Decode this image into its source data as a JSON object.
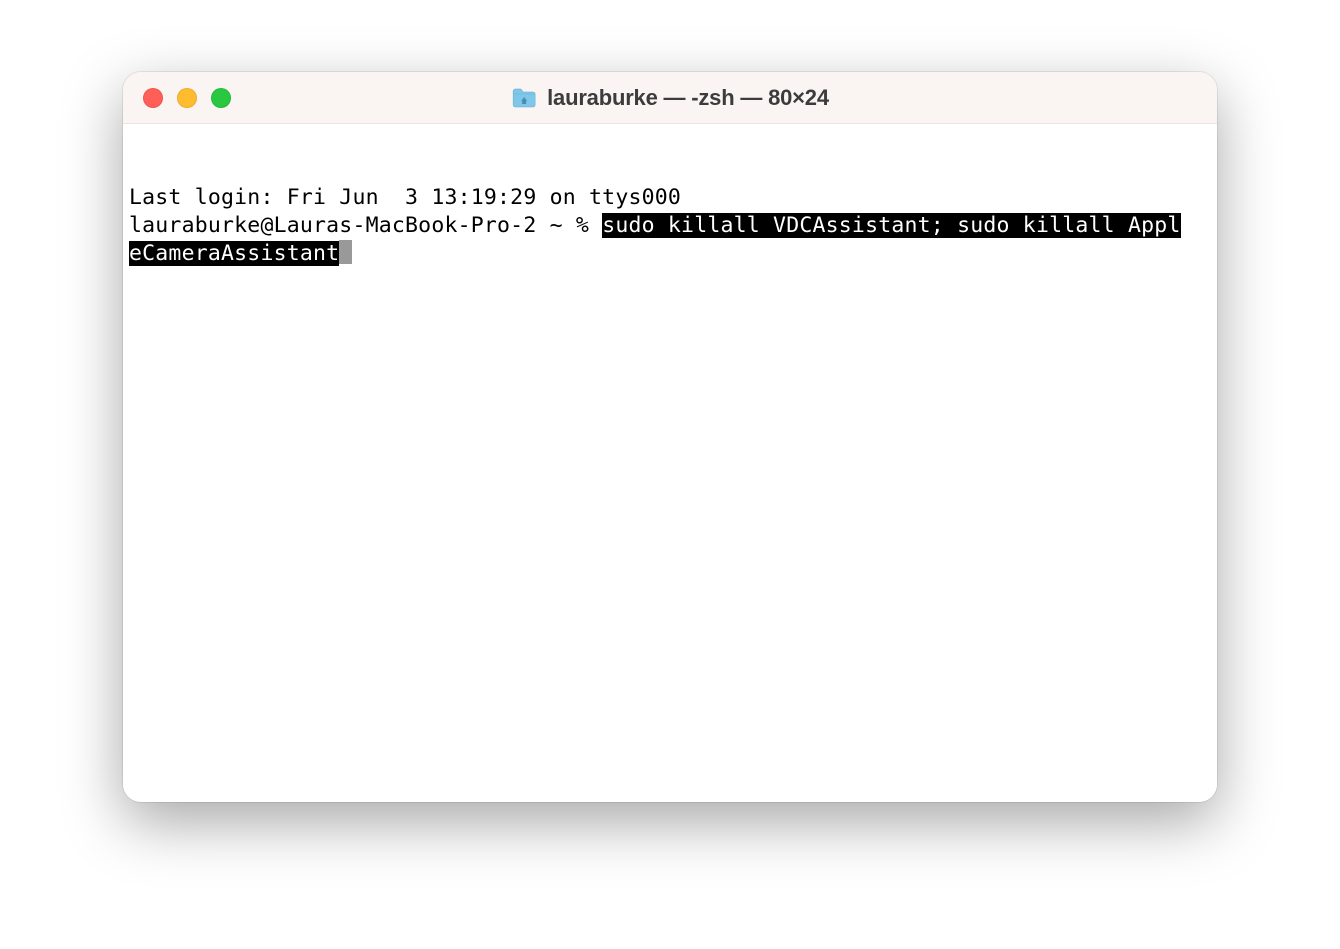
{
  "window": {
    "title": "lauraburke — -zsh — 80×24"
  },
  "terminal": {
    "last_login": "Last login: Fri Jun  3 13:19:29 on ttys000",
    "prompt": "lauraburke@Lauras-MacBook-Pro-2 ~ % ",
    "command_selected_line1": "sudo killall VDCAssistant; sudo killall Appl",
    "command_selected_line2": "eCameraAssistant"
  }
}
